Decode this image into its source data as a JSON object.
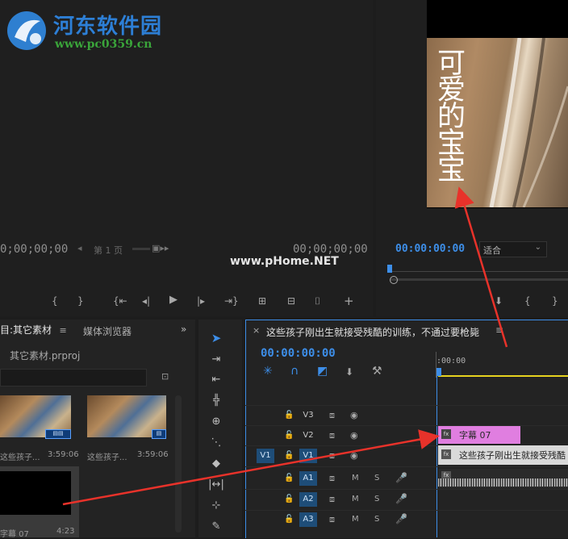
{
  "watermark": {
    "site_name": "河东软件园",
    "site_url": "www.pc0359.cn",
    "center_text": "www.pHome.NET"
  },
  "source_monitor": {
    "timecode_left": "0;00;00;00",
    "timecode_right": "00;00;00;00",
    "page_label": "第 1 页"
  },
  "program_monitor": {
    "timecode": "00:00:00:00",
    "fit_label": "适合",
    "caption_text": "可爱的宝宝"
  },
  "project_panel": {
    "tab_project": "目:其它素材",
    "tab_media_browser": "媒体浏览器",
    "file_name": "其它素材.prproj",
    "items": [
      {
        "name": "这些孩子...",
        "duration": "3:59:06"
      },
      {
        "name": "这些孩子...",
        "duration": "3:59:06"
      },
      {
        "name": "字幕 07",
        "duration": "4:23"
      }
    ]
  },
  "timeline": {
    "sequence_title": "这些孩子刚出生就接受残酷的训练，不通过要枪毙",
    "timecode": "00:00:00:00",
    "ruler_start": ":00:00",
    "tracks": {
      "v3": "V3",
      "v2": "V2",
      "v1": "V1",
      "v1_source": "V1",
      "a1": "A1",
      "a2": "A2",
      "a3": "A3",
      "mute": "M",
      "solo": "S"
    },
    "clips": {
      "title_clip": "字幕 07",
      "video_clip": "这些孩子刚出生就接受残酷",
      "fx": "fx"
    }
  },
  "colors": {
    "accent_blue": "#3d8ee8",
    "title_clip": "#e07ee0",
    "annotation_arrow": "#e8322a",
    "playhead": "#e6d21e"
  }
}
